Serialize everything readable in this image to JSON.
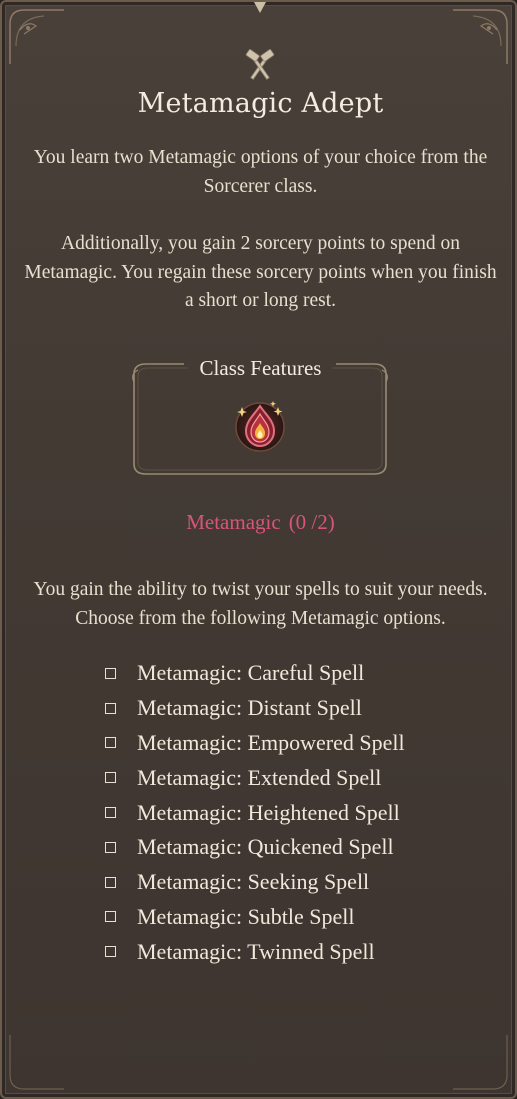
{
  "feature": {
    "icon": "crossed-hammers-icon",
    "title": "Metamagic Adept",
    "description_1": "You learn two Metamagic options of your choice from the Sorcerer class.",
    "description_2": "Additionally, you gain 2 sorcery points to spend on Metamagic. You regain these sorcery points when you finish a short or long rest."
  },
  "class_features": {
    "label": "Class Features",
    "icon": "sorcery-flame-icon"
  },
  "metamagic": {
    "label": "Metamagic",
    "count": "(0 /2)",
    "selected": 0,
    "max": 2,
    "description": "You gain the ability to twist your spells to suit your needs. Choose from the following Metamagic options.",
    "options": [
      {
        "label": "Metamagic: Careful Spell",
        "checked": false
      },
      {
        "label": "Metamagic: Distant Spell",
        "checked": false
      },
      {
        "label": "Metamagic: Empowered Spell",
        "checked": false
      },
      {
        "label": "Metamagic: Extended Spell",
        "checked": false
      },
      {
        "label": "Metamagic: Heightened Spell",
        "checked": false
      },
      {
        "label": "Metamagic: Quickened Spell",
        "checked": false
      },
      {
        "label": "Metamagic: Seeking Spell",
        "checked": false
      },
      {
        "label": "Metamagic: Subtle Spell",
        "checked": false
      },
      {
        "label": "Metamagic: Twinned Spell",
        "checked": false
      }
    ]
  },
  "colors": {
    "accent_pink": "#d8557a",
    "text": "#ece4d6",
    "panel": "#433a34",
    "frame": "#8c7a64"
  }
}
